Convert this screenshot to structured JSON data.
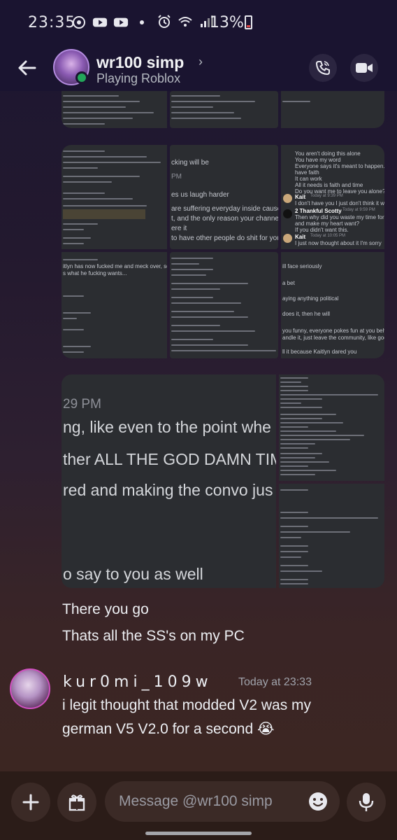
{
  "status_bar": {
    "time": "23:35",
    "battery": "13%",
    "icons": [
      "sync-icon",
      "youtube-icon",
      "youtube-icon",
      "dot-icon",
      "alarm-icon",
      "wifi-icon",
      "signal-icon",
      "battery-icon"
    ]
  },
  "header": {
    "back_icon": "arrow-left-icon",
    "contact_name": "wr100 simp",
    "chevron": "›",
    "activity": "Playing Roblox",
    "call_icon": "phone-icon",
    "video_icon": "video-icon"
  },
  "screenshots": {
    "middle_text": [
      "cking will be",
      "PM",
      "es us laugh harder",
      "are suffering everyday inside cause you really ha",
      "t, and the only reason your channel hasn't died i",
      "ere it",
      "to have other people do shit for you, cause you c"
    ],
    "right_chat": {
      "lines": [
        "You aren't doing this alone",
        "You have my word",
        "Everyone says it's meant to happen... we just have to",
        "have faith",
        "It can work",
        "All it needs is faith and time",
        "Do you want me to leave you alone?"
      ],
      "m1_user": "Kait",
      "m1_time": "Today at 9:39 PM",
      "m1_text": "I don't have you I just don't think it will work",
      "m2_user": "2 Thankful Scotty",
      "m2_time": "Today at 9:59 PM",
      "m2_text1": "Then why did you waste my time for several days,",
      "m2_text2": "and make my heart want?",
      "m2_text3": "If you didn't want this.",
      "m3_user": "Kait",
      "m3_time": "Today at 10:05 PM",
      "m3_text": "I just now thought about it I'm sorry"
    },
    "row3_left": [
      "itlyn has now fucked me and meck over, so now you can be his",
      "s what he fucking wants..."
    ],
    "row3_right": [
      "ill face seriously",
      "a bet",
      "aying anything political",
      "does it, then he will",
      "you funny, everyone pokes fun at you behind you're back now, i mean",
      "andle it, just leave the community, like god damn",
      "ll it because Kaitlyn dared you"
    ],
    "big": {
      "time": "29 PM",
      "line1": "ng, like even to the point whe",
      "line2": "ther ALL THE GOD DAMN TIM",
      "line3": "red and making the convo jus",
      "line4": "o say to you as well"
    }
  },
  "messages": [
    {
      "text": "There you go"
    },
    {
      "text": "Thats all the SS's on my PC"
    }
  ],
  "second_message": {
    "username": "kur0mi_109w",
    "timestamp": "Today at 23:33",
    "line1": "i legit thought that modded V2 was my",
    "line2": "german V5 V2.0 for a second",
    "emoji": "😭"
  },
  "composer": {
    "placeholder": "Message @wr100 simp",
    "add_icon": "plus-icon",
    "gift_icon": "gift-icon",
    "emoji_icon": "smile-icon",
    "mic_icon": "microphone-icon"
  }
}
